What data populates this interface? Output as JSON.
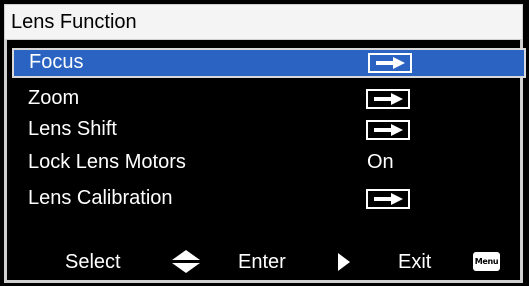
{
  "title": "Lens Function",
  "colors": {
    "background": "#000000",
    "selection": "#2a63c2",
    "title_bar": "#f4f4f4",
    "text": "#ffffff"
  },
  "menu": {
    "items": [
      {
        "label": "Focus",
        "type": "submenu",
        "icon": "enter-arrow-icon"
      },
      {
        "label": "Zoom",
        "type": "submenu",
        "icon": "enter-arrow-icon"
      },
      {
        "label": "Lens Shift",
        "type": "submenu",
        "icon": "enter-arrow-icon"
      },
      {
        "label": "Lock Lens Motors",
        "type": "value",
        "value": "On"
      },
      {
        "label": "Lens Calibration",
        "type": "submenu",
        "icon": "enter-arrow-icon"
      }
    ],
    "selected_index": 0
  },
  "footer": {
    "select_label": "Select",
    "select_icon": "up-down-icon",
    "enter_label": "Enter",
    "enter_icon": "right-triangle-icon",
    "exit_label": "Exit",
    "menu_key_label": "Menu"
  }
}
